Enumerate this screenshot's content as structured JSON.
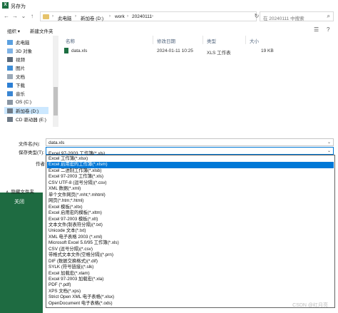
{
  "window": {
    "title": "另存为",
    "app_icon": "excel-icon"
  },
  "address": {
    "segments": [
      "此电脑",
      "新加卷 (D:)",
      "work",
      "20240111"
    ],
    "search_placeholder": "在 20240111 中搜索"
  },
  "toolbar": {
    "organize": "组织",
    "new_folder": "新建文件夹"
  },
  "nav": {
    "items": [
      {
        "label": "此电脑",
        "icon": "computer-icon"
      },
      {
        "label": "3D 对象",
        "icon": "3d-objects-icon"
      },
      {
        "label": "视频",
        "icon": "video-icon"
      },
      {
        "label": "图片",
        "icon": "pictures-icon"
      },
      {
        "label": "文档",
        "icon": "documents-icon"
      },
      {
        "label": "下载",
        "icon": "download-icon"
      },
      {
        "label": "音乐",
        "icon": "music-icon"
      },
      {
        "label": "OS (C:)",
        "icon": "drive-icon"
      },
      {
        "label": "新加卷 (D:)",
        "icon": "drive-icon"
      },
      {
        "label": "CD 驱动器 (E:)",
        "icon": "cd-drive-icon"
      }
    ],
    "selected": "新加卷 (D:)"
  },
  "file_list": {
    "columns": [
      "名称",
      "修改日期",
      "类型",
      "大小"
    ],
    "rows": [
      {
        "name": "data.xls",
        "modified": "2024-01-11 10:25",
        "type": "XLS 工作表",
        "size": "19 KB"
      }
    ]
  },
  "form": {
    "filename_label": "文件名(N):",
    "filename_value": "data.xls",
    "type_label": "保存类型(T):",
    "type_value": "Excel 97-2003 工作簿(*.xls)",
    "author_label": "作者"
  },
  "hide_folders": "隐藏文件夹",
  "backstage": {
    "close": "关闭"
  },
  "dropdown_options": [
    "Excel 工作簿(*.xlsx)",
    "Excel 启用宏的工作簿(*.xlsm)",
    "Excel 二进制工作簿(*.xlsb)",
    "Excel 97-2003 工作簿(*.xls)",
    "CSV UTF-8 (逗号分隔)(*.csv)",
    "XML 数据(*.xml)",
    "单个文件网页(*.mht;*.mhtml)",
    "网页(*.htm;*.html)",
    "Excel 模板(*.xltx)",
    "Excel 启用宏的模板(*.xltm)",
    "Excel 97-2003 模板(*.xlt)",
    "文本文件(制表符分隔)(*.txt)",
    "Unicode 文本(*.txt)",
    "XML 电子表格 2003 (*.xml)",
    "Microsoft Excel 5.0/95 工作簿(*.xls)",
    "CSV (逗号分隔)(*.csv)",
    "带格式文本文件(空格分隔)(*.prn)",
    "DIF (数据交换格式)(*.dif)",
    "SYLK (符号链接)(*.slk)",
    "Excel 加载宏(*.xlam)",
    "Excel 97-2003 加载宏(*.xla)",
    "PDF (*.pdf)",
    "XPS 文档(*.xps)",
    "Strict Open XML 电子表格(*.xlsx)",
    "OpenDocument 电子表格(*.ods)"
  ],
  "dropdown_selected_index": 1,
  "watermark": "CSDN @红月亮"
}
